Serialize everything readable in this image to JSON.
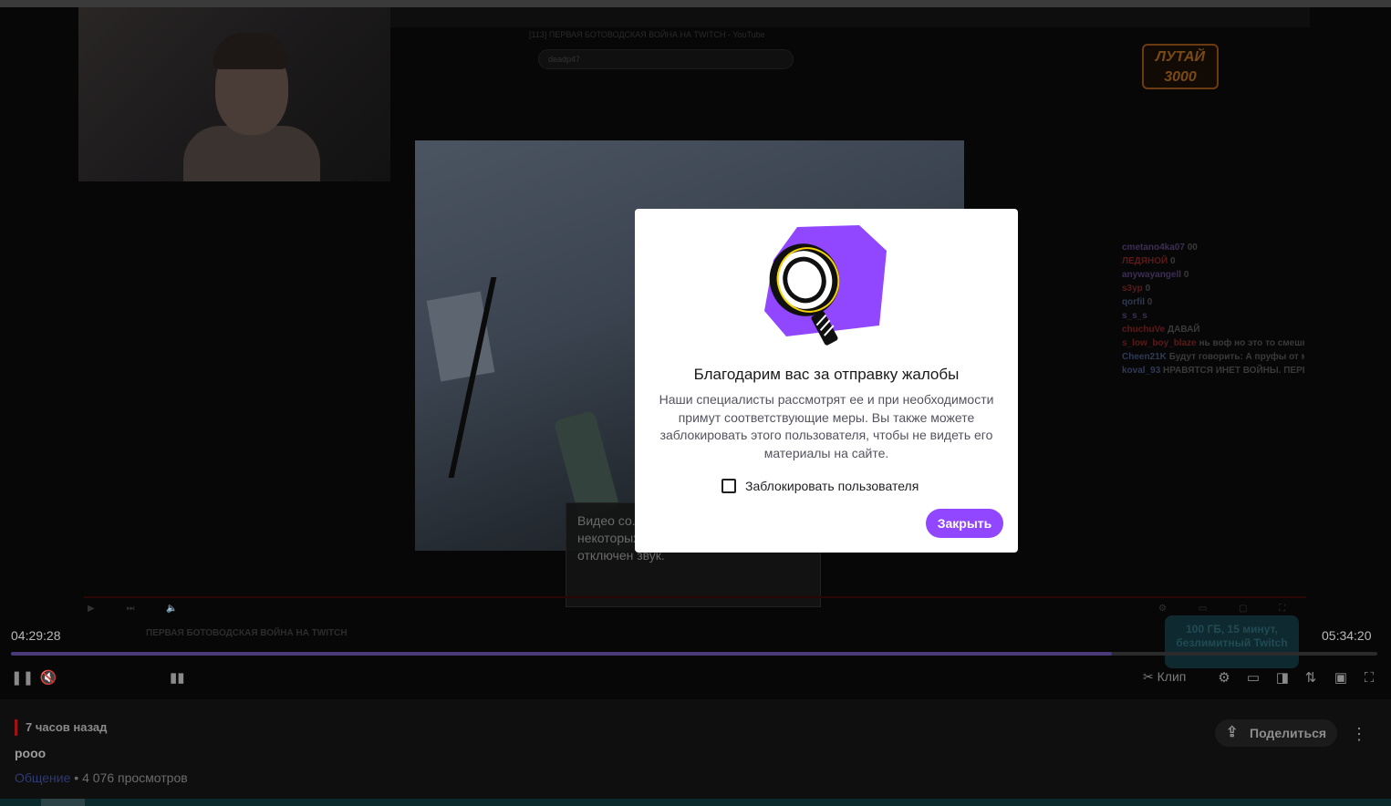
{
  "player": {
    "inner_title": "[113] ПЕРВАЯ БОТОВОДСКАЯ ВОЙНА НА TWITCH - YouTube",
    "inner_search": "deadp47",
    "banner_line1": "ЛУТАЙ",
    "banner_line2": "3000",
    "notice_text": "Видео со... принадле... стороне. В некоторых его фрагментах будет отключен звук.",
    "inner_stream_title": "ПЕРВАЯ БОТОВОДСКАЯ ВОЙНА НА TWITCH",
    "promo_text": "100 ГБ, 15 минут, безлимитный Twitch",
    "time_current": "04:29:28",
    "time_total": "05:34:20",
    "progress": 0.806,
    "clip_label": "Клип"
  },
  "chat": [
    {
      "user": "cmetano4ka07",
      "text": "00",
      "cls": "u1"
    },
    {
      "user": "ЛЕДЯНОЙ",
      "text": "0",
      "cls": "u2"
    },
    {
      "user": "anywayangell",
      "text": "0",
      "cls": "u1"
    },
    {
      "user": "s3yp",
      "text": "0",
      "cls": "u2"
    },
    {
      "user": "qorfil",
      "text": "0",
      "cls": "u3"
    },
    {
      "user": "s_s_s",
      "text": "",
      "cls": "u1"
    },
    {
      "user": "chuchuVe",
      "text": "ДАВАЙ",
      "cls": "u2"
    },
    {
      "user": "s_low_boy_blaze",
      "text": "нь воф но это то смешно правда",
      "cls": "u2"
    },
    {
      "user": "Cheen21K",
      "text": "Будут говорить: А пруфы от мамы будут?",
      "cls": "u3"
    },
    {
      "user": "koval_93",
      "text": "НРАВЯТСЯ ИНЕТ ВОЙНЫ. ПЕРЕСТРЕЛКА КАКАШКАМИ СКВОЗЬ МОНИТОРЫ .",
      "cls": "u3"
    }
  ],
  "stream": {
    "ago": "7 часов назад",
    "title": "рооо",
    "category": "Общение",
    "views": " • 4 076 просмотров",
    "share_label": "Поделиться"
  },
  "modal": {
    "title": "Благодарим вас за отправку жалобы",
    "text": "Наши специалисты рассмотрят ее и при необходимости примут соответствующие меры. Вы также можете заблокировать этого пользователя, чтобы не видеть его материалы на сайте.",
    "checkbox_label": "Заблокировать пользователя",
    "close_label": "Закрыть",
    "accent": "#9147ff"
  },
  "icons": {
    "pause": "pause-icon",
    "mute": "volume-muted-icon",
    "settings": "gear-icon",
    "theatre": "theatre-mode-icon",
    "fullscreen": "fullscreen-icon",
    "share": "share-icon",
    "more": "vertical-dots-icon",
    "illustration": "magnifier-icon"
  }
}
